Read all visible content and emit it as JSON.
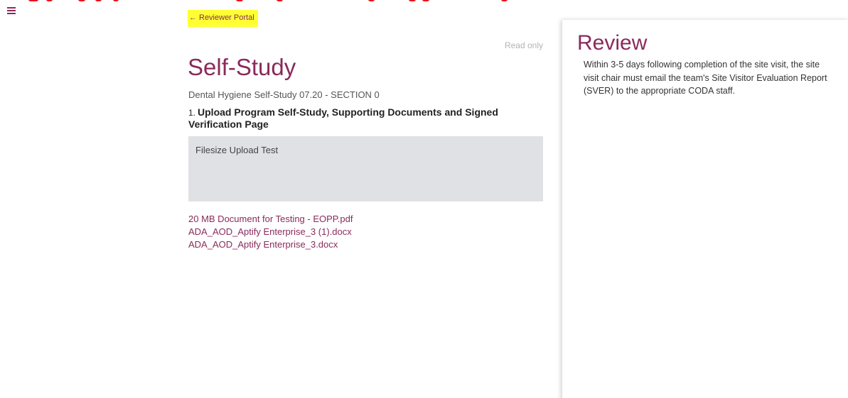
{
  "nav": {
    "menu_icon": "hamburger-menu-icon",
    "back_arrow": "←",
    "back_label": "Reviewer Portal"
  },
  "main": {
    "read_only_label": "Read only",
    "title": "Self-Study",
    "subtitle": "Dental Hygiene Self-Study 07.20 - SECTION 0",
    "question": {
      "number": "1.",
      "text": "Upload Program Self-Study, Supporting Documents and Signed Verification Page"
    },
    "answer_text": "Filesize Upload Test",
    "files": [
      "20 MB Document for Testing - EOPP.pdf",
      "ADA_AOD_Aptify Enterprise_3 (1).docx",
      "ADA_AOD_Aptify Enterprise_3.docx"
    ]
  },
  "review": {
    "title": "Review",
    "text": "Within 3-5 days following completion of the site visit, the site visit chair must email the team's Site Visitor Evaluation Report (SVER) to the appropriate CODA staff."
  },
  "colors": {
    "accent": "#8a2a5b",
    "highlight": "#ffff33",
    "annotation_red": "#e8141b",
    "answer_bg": "#dfe1e4"
  }
}
